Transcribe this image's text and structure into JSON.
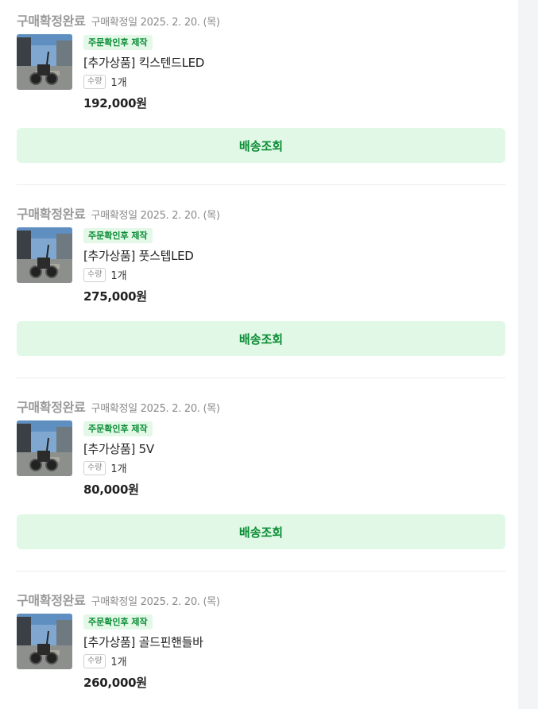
{
  "orders": [
    {
      "status": "구매확정완료",
      "confirm_date": "구매확정일 2025. 2. 20. (목)",
      "badge": "주문확인후 제작",
      "product_name": "[추가상품] 킥스텐드LED",
      "qty_label": "수량",
      "qty_value": "1개",
      "price": "192,000원",
      "ship_button": "배송조회"
    },
    {
      "status": "구매확정완료",
      "confirm_date": "구매확정일 2025. 2. 20. (목)",
      "badge": "주문확인후 제작",
      "product_name": "[추가상품] 풋스텝LED",
      "qty_label": "수량",
      "qty_value": "1개",
      "price": "275,000원",
      "ship_button": "배송조회"
    },
    {
      "status": "구매확정완료",
      "confirm_date": "구매확정일 2025. 2. 20. (목)",
      "badge": "주문확인후 제작",
      "product_name": "[추가상품] 5V",
      "qty_label": "수량",
      "qty_value": "1개",
      "price": "80,000원",
      "ship_button": "배송조회"
    },
    {
      "status": "구매확정완료",
      "confirm_date": "구매확정일 2025. 2. 20. (목)",
      "badge": "주문확인후 제작",
      "product_name": "[추가상품] 골드핀핸들바",
      "qty_label": "수량",
      "qty_value": "1개",
      "price": "260,000원"
    }
  ],
  "colors": {
    "accent_green": "#0a8c35",
    "button_bg": "#e0f8e5",
    "badge_bg": "#e3f8e7"
  }
}
